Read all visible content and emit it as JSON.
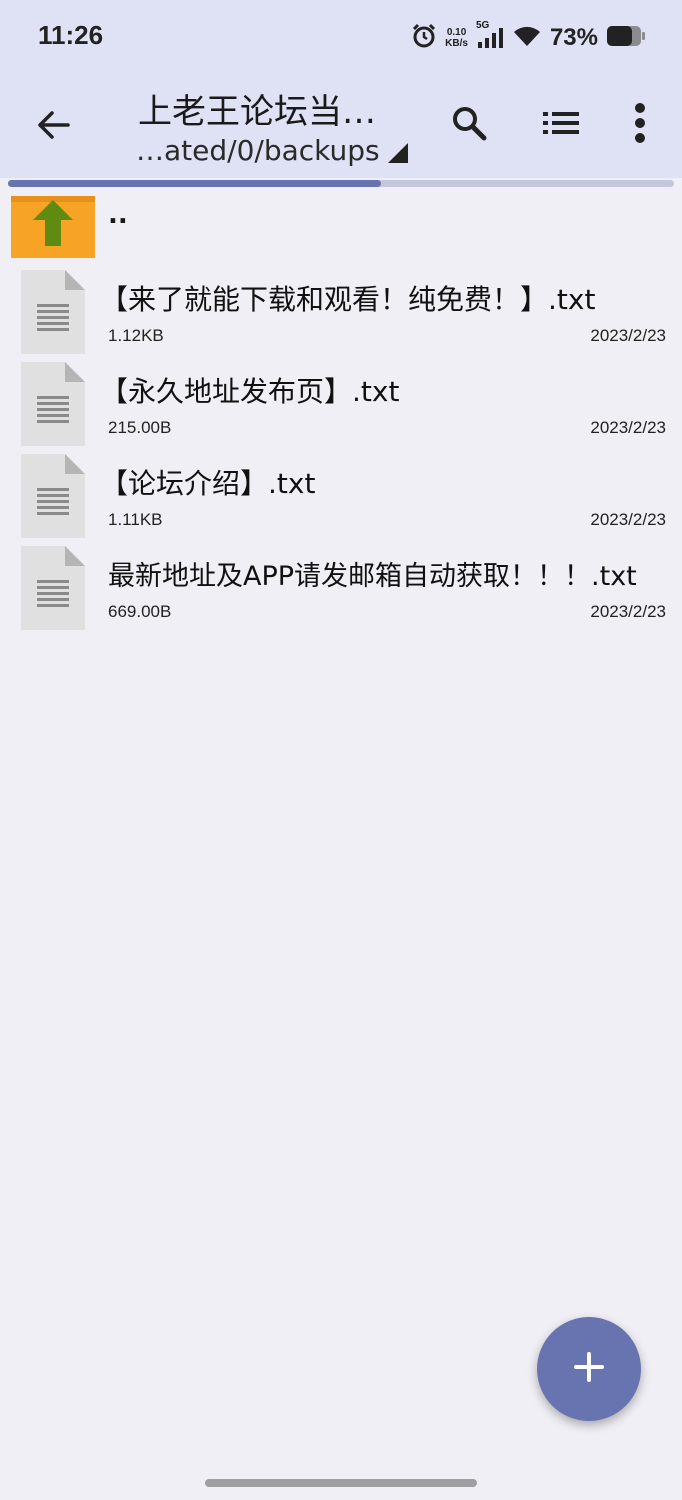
{
  "status": {
    "time": "11:26",
    "net_speed_value": "0.10",
    "net_speed_unit": "KB/s",
    "network": "5G",
    "battery": "73%"
  },
  "appbar": {
    "title": "上老王论坛当…",
    "path": "…ated/0/backups",
    "icons": [
      "back-arrow-icon",
      "search-icon",
      "list-view-icon",
      "more-vert-icon"
    ]
  },
  "progress": {
    "fraction": 0.56
  },
  "files": {
    "parent_label": "..",
    "items": [
      {
        "name": "【来了就能下载和观看！纯免费！】.txt",
        "size": "1.12KB",
        "date": "2023/2/23"
      },
      {
        "name": "【永久地址发布页】.txt",
        "size": "215.00B",
        "date": "2023/2/23"
      },
      {
        "name": "【论坛介绍】.txt",
        "size": "1.11KB",
        "date": "2023/2/23"
      },
      {
        "name": "最新地址及APP请发邮箱自动获取！！！.txt",
        "size": "669.00B",
        "date": "2023/2/23"
      }
    ]
  },
  "colors": {
    "appbar_bg": "#dfe1f5",
    "accent": "#6774b0",
    "folder": "#f7a325",
    "up_arrow": "#5f8c10"
  }
}
